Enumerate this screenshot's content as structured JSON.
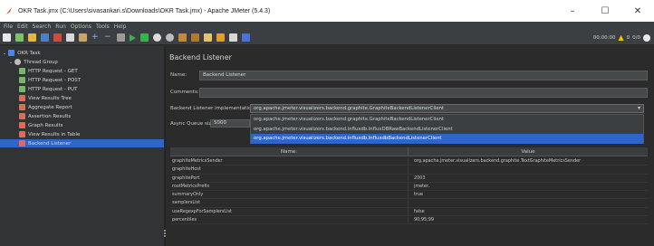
{
  "window": {
    "title": "OKR Task.jmx (C:\\Users\\sivasankari.s\\Downloads\\OKR Task.jmx) - Apache JMeter (5.4.3)",
    "minimize": "–",
    "maximize": "☐",
    "close": "✕"
  },
  "menu": [
    "File",
    "Edit",
    "Search",
    "Run",
    "Options",
    "Tools",
    "Help"
  ],
  "toolbar": {
    "timer": "00:00:00",
    "warnings": "0",
    "threads": "0/0"
  },
  "tree": {
    "root": "OKR Task",
    "thread_group": "Thread Group",
    "items": [
      "HTTP Request - GET",
      "HTTP Request - POST",
      "HTTP Request - PUT",
      "View Results Tree",
      "Aggregate Report",
      "Assertion Results",
      "Graph Results",
      "View Results in Table",
      "Backend Listener"
    ]
  },
  "panel": {
    "title": "Backend Listener",
    "name_label": "Name:",
    "name_value": "Backend Listener",
    "comments_label": "Comments:",
    "comments_value": "",
    "impl_label": "Backend Listener implementation",
    "impl_value": "org.apache.jmeter.visualizers.backend.graphite.GraphiteBackendListenerClient",
    "async_label": "Async Queue size",
    "async_value": "5000",
    "options": [
      "org.apache.jmeter.visualizers.backend.graphite.GraphiteBackendListenerClient",
      "org.apache.jmeter.visualizers.backend.influxdb.InfluxDBRawBackendListenerClient",
      "org.apache.jmeter.visualizers.backend.influxdb.InfluxdbBackendListenerClient"
    ],
    "table": {
      "headers": [
        "Name:",
        "Value"
      ],
      "rows": [
        {
          "name": "graphiteMetricsSender",
          "value": "org.apache.jmeter.visualizers.backend.graphite.TextGraphiteMetricsSender"
        },
        {
          "name": "graphiteHost",
          "value": ""
        },
        {
          "name": "graphitePort",
          "value": "2003"
        },
        {
          "name": "rootMetricsPrefix",
          "value": "jmeter."
        },
        {
          "name": "summaryOnly",
          "value": "true"
        },
        {
          "name": "samplersList",
          "value": ""
        },
        {
          "name": "useRegexpForSamplersList",
          "value": "false"
        },
        {
          "name": "percentiles",
          "value": "90;95;99"
        }
      ]
    }
  },
  "colors": {
    "selection": "#2f65ca",
    "background": "#2b2b2b",
    "tree_bg": "#313335"
  }
}
